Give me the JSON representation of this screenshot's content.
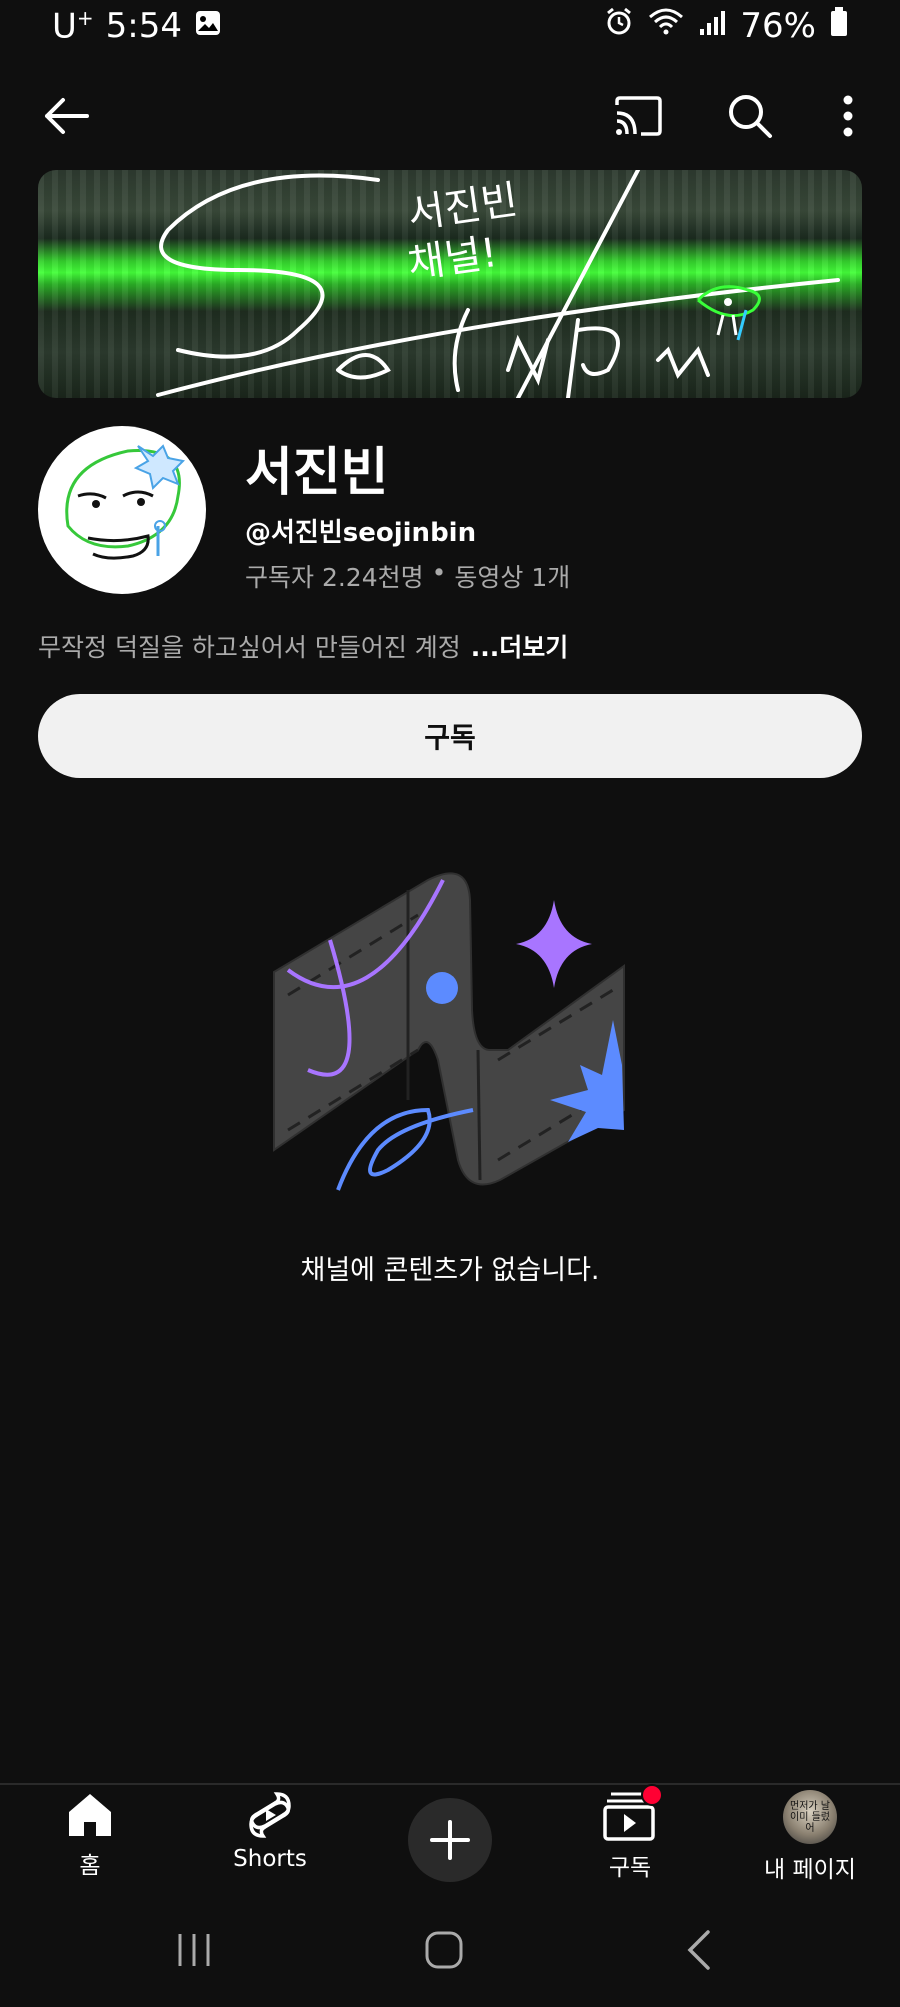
{
  "status_bar": {
    "carrier": "U",
    "carrier_sup": "+",
    "time": "5:54",
    "battery": "76%"
  },
  "top_bar": {
    "back_icon": "arrow-left-icon",
    "cast_icon": "cast-icon",
    "search_icon": "search-icon",
    "more_icon": "more-vert-icon"
  },
  "channel": {
    "name": "서진빈",
    "handle": "@서진빈seojinbin",
    "subscribers": "구독자 2.24천명",
    "separator": "•",
    "videos": "동영상 1개",
    "description": "무작정 덕질을 하고싶어서 만들어진 계정",
    "more_label": "...더보기",
    "subscribe_label": "구독"
  },
  "banner": {
    "text_top": "서진빈",
    "text_mid": "채널!",
    "signature": "Seojinbin."
  },
  "empty_state": {
    "message": "채널에 콘텐츠가 없습니다."
  },
  "bottom_nav": {
    "items": [
      {
        "label": "홈",
        "icon": "home-icon"
      },
      {
        "label": "Shorts",
        "icon": "shorts-icon"
      },
      {
        "label": "",
        "icon": "create-plus-icon"
      },
      {
        "label": "구독",
        "icon": "subscriptions-icon"
      },
      {
        "label": "내 페이지",
        "icon": "profile-avatar"
      }
    ],
    "avatar_text": "먼저가 날이미 들렀어"
  },
  "colors": {
    "background": "#0f0f0f",
    "accent_purple": "#a875ff",
    "accent_blue": "#5c8bff",
    "notification_dot": "#ff0033"
  }
}
